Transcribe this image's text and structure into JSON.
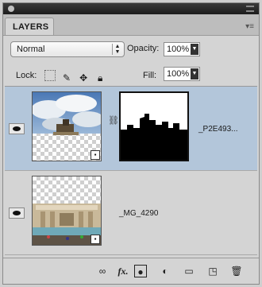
{
  "panel": {
    "tab_label": "LAYERS",
    "blend_mode": "Normal",
    "opacity_label": "Opacity:",
    "opacity_value": "100%",
    "lock_label": "Lock:",
    "fill_label": "Fill:",
    "fill_value": "100%"
  },
  "layers": [
    {
      "name": "_P2E493...",
      "visible": true,
      "selected": true,
      "has_mask": true,
      "smart_object": true
    },
    {
      "name": "_MG_4290",
      "visible": true,
      "selected": false,
      "has_mask": false,
      "smart_object": true
    }
  ],
  "footer": {
    "icons": [
      "link-layers-icon",
      "fx-icon",
      "add-mask-icon",
      "adjustment-layer-icon",
      "new-group-icon",
      "new-layer-icon",
      "trash-icon"
    ],
    "fx_text": "fx."
  },
  "colors": {
    "selected_row": "#b3c6da",
    "panel_bg": "#d4d4d4"
  }
}
